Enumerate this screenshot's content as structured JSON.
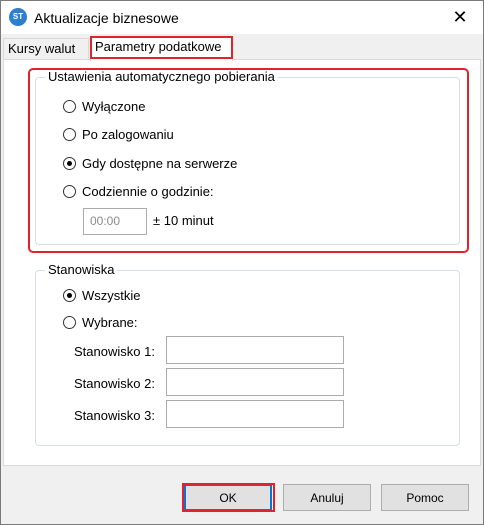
{
  "window": {
    "title": "Aktualizacje biznesowe",
    "app_icon_text": "ST",
    "close_glyph": "✕"
  },
  "tabs": [
    {
      "label": "Kursy walut",
      "active": false
    },
    {
      "label": "Parametry podatkowe",
      "active": true
    }
  ],
  "auto_download": {
    "title": "Ustawienia automatycznego pobierania",
    "options": [
      {
        "label": "Wyłączone",
        "checked": false
      },
      {
        "label": "Po zalogowaniu",
        "checked": false
      },
      {
        "label": "Gdy dostępne na serwerze",
        "checked": true
      },
      {
        "label": "Codziennie o godzinie:",
        "checked": false
      }
    ],
    "time_value": "00:00",
    "tolerance_label": "± 10 minut"
  },
  "workstations": {
    "title": "Stanowiska",
    "options": [
      {
        "label": "Wszystkie",
        "checked": true
      },
      {
        "label": "Wybrane:",
        "checked": false
      }
    ],
    "fields": [
      {
        "label": "Stanowisko 1:",
        "value": ""
      },
      {
        "label": "Stanowisko 2:",
        "value": ""
      },
      {
        "label": "Stanowisko 3:",
        "value": ""
      }
    ]
  },
  "buttons": {
    "ok": "OK",
    "cancel": "Anuluj",
    "help": "Pomoc"
  },
  "colors": {
    "highlight": "#e0242b",
    "accent": "#0078d7"
  }
}
